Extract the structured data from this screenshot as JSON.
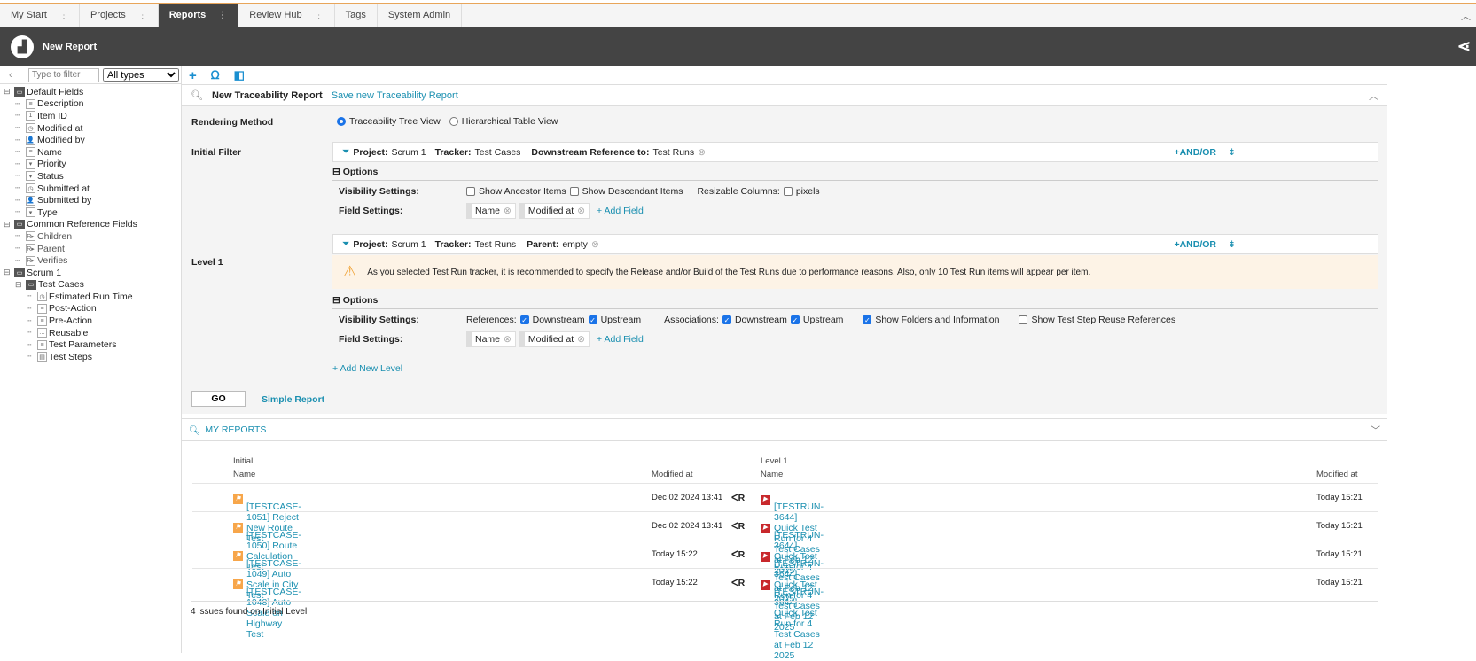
{
  "tabs": [
    {
      "label": "My Start"
    },
    {
      "label": "Projects"
    },
    {
      "label": "Reports"
    },
    {
      "label": "Review Hub"
    },
    {
      "label": "Tags"
    },
    {
      "label": "System Admin"
    }
  ],
  "header": {
    "title": "New Report"
  },
  "sidebar": {
    "filter_placeholder": "Type to filter",
    "type_select": "All types",
    "tree": [
      {
        "label": "Default Fields",
        "level": 0,
        "kind": "folder"
      },
      {
        "label": "Description",
        "level": 1,
        "icon": "≡"
      },
      {
        "label": "Item ID",
        "level": 1,
        "icon": "1"
      },
      {
        "label": "Modified at",
        "level": 1,
        "icon": "◷"
      },
      {
        "label": "Modified by",
        "level": 1,
        "icon": "👤"
      },
      {
        "label": "Name",
        "level": 1,
        "icon": "≡"
      },
      {
        "label": "Priority",
        "level": 1,
        "icon": "▾"
      },
      {
        "label": "Status",
        "level": 1,
        "icon": "▾"
      },
      {
        "label": "Submitted at",
        "level": 1,
        "icon": "◷"
      },
      {
        "label": "Submitted by",
        "level": 1,
        "icon": "👤"
      },
      {
        "label": "Type",
        "level": 1,
        "icon": "▾"
      },
      {
        "label": "Common Reference Fields",
        "level": 0,
        "kind": "folder"
      },
      {
        "label": "Children",
        "level": 1,
        "icon": "R▸"
      },
      {
        "label": "Parent",
        "level": 1,
        "icon": "R▸"
      },
      {
        "label": "Verifies",
        "level": 1,
        "icon": "R▸"
      },
      {
        "label": "Scrum 1",
        "level": 0,
        "kind": "folder"
      },
      {
        "label": "Test Cases",
        "level": 1,
        "kind": "folder"
      },
      {
        "label": "Estimated Run Time",
        "level": 2,
        "icon": "◷"
      },
      {
        "label": "Post-Action",
        "level": 2,
        "icon": "≡"
      },
      {
        "label": "Pre-Action",
        "level": 2,
        "icon": "≡"
      },
      {
        "label": "Reusable",
        "level": 2,
        "icon": "…"
      },
      {
        "label": "Test Parameters",
        "level": 2,
        "icon": "≡"
      },
      {
        "label": "Test Steps",
        "level": 2,
        "icon": "▤"
      }
    ]
  },
  "report": {
    "title": "New Traceability Report",
    "save_link": "Save new Traceability Report",
    "rendering_label": "Rendering Method",
    "render_opt1": "Traceability Tree View",
    "render_opt2": "Hierarchical Table View",
    "initial_label": "Initial Filter",
    "level1_label": "Level 1",
    "f1": {
      "project_k": "Project:",
      "project_v": "Scrum 1",
      "tracker_k": "Tracker:",
      "tracker_v": "Test Cases",
      "ref_k": "Downstream Reference to:",
      "ref_v": "Test Runs"
    },
    "f2": {
      "project_k": "Project:",
      "project_v": "Scrum 1",
      "tracker_k": "Tracker:",
      "tracker_v": "Test Runs",
      "ref_k": "Parent:",
      "ref_v": "empty"
    },
    "andor": "+AND/OR",
    "options": "Options",
    "vis_label": "Visibility Settings:",
    "field_label": "Field Settings:",
    "show_ancestor": "Show Ancestor Items",
    "show_descendant": "Show Descendant Items",
    "resizable": "Resizable Columns:",
    "pixels": "pixels",
    "field1": "Name",
    "field2": "Modified at",
    "add_field": "+ Add Field",
    "warning": "As you selected Test Run tracker, it is recommended to specify the Release and/or Build of the Test Runs due to performance reasons. Also, only 10 Test Run items will appear per item.",
    "references": "References:",
    "downstream": "Downstream",
    "upstream": "Upstream",
    "associations": "Associations:",
    "show_folders": "Show Folders and Information",
    "show_reuse": "Show Test Step Reuse References",
    "add_level": "+ Add New Level",
    "go": "GO",
    "simple": "Simple Report"
  },
  "my_reports": {
    "title": "MY REPORTS",
    "initial": "Initial",
    "level1": "Level 1",
    "name": "Name",
    "modified": "Modified at",
    "rows": [
      {
        "name": "[TESTCASE-1051] Reject New Route Test",
        "mod": "Dec 02 2024 13:41",
        "rel": "ᐸR",
        "child": "[TESTRUN-3644] Quick Test Run for 4 Test Cases at Feb 12 2025",
        "cmod": "Today 15:21"
      },
      {
        "name": "[TESTCASE-1050] Route Calculation Test",
        "mod": "Dec 02 2024 13:41",
        "rel": "ᐸR",
        "child": "[TESTRUN-3644] Quick Test Run for 4 Test Cases at Feb 12 2025",
        "cmod": "Today 15:21"
      },
      {
        "name": "[TESTCASE-1049] Auto Scale in City Test",
        "mod": "Today 15:22",
        "rel": "ᐸR",
        "child": "[TESTRUN-3644] Quick Test Run for 4 Test Cases at Feb 12 2025",
        "cmod": "Today 15:21"
      },
      {
        "name": "[TESTCASE-1048] Auto Scale on Highway Test",
        "mod": "Today 15:22",
        "rel": "ᐸR",
        "child": "[TESTRUN-3644] Quick Test Run for 4 Test Cases at Feb 12 2025",
        "cmod": "Today 15:21"
      }
    ],
    "footer": "4 issues found on Initial Level"
  }
}
